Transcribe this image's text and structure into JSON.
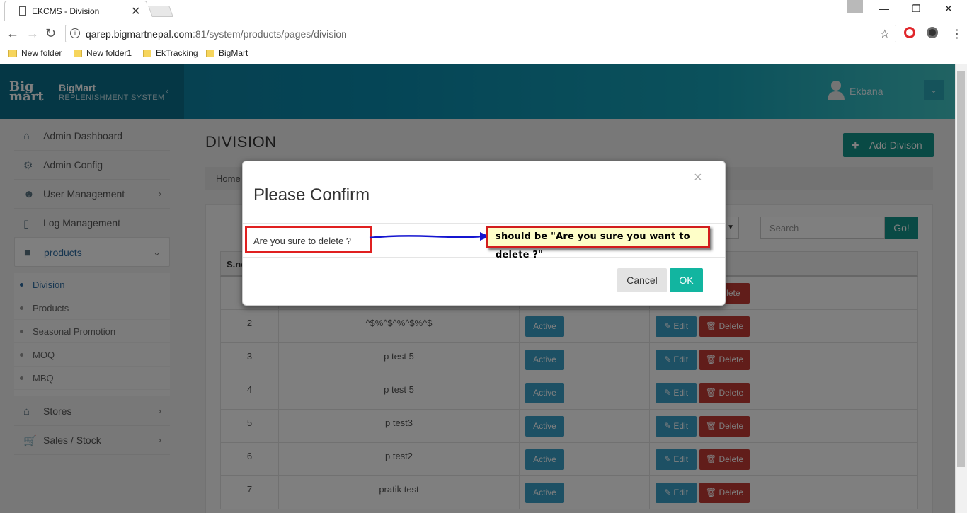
{
  "browser": {
    "tab_title": "EKCMS - Division",
    "url_host": "qarep.bigmartnepal.com",
    "url_rest": ":81/system/products/pages/division",
    "bookmarks": [
      "New folder",
      "New folder1",
      "EkTracking",
      "BigMart"
    ]
  },
  "header": {
    "brand_name": "BigMart",
    "brand_sub": "REPLENISHMENT SYSTEM",
    "user_name": "Ekbana"
  },
  "sidebar": {
    "items": [
      {
        "label": "Admin Dashboard",
        "icon": "home-icon"
      },
      {
        "label": "Admin Config",
        "icon": "gear-icon"
      },
      {
        "label": "User Management",
        "icon": "users-icon"
      },
      {
        "label": "Log Management",
        "icon": "file-icon"
      },
      {
        "label": "products",
        "icon": "briefcase-icon"
      },
      {
        "label": "Stores",
        "icon": "home-icon"
      },
      {
        "label": "Sales / Stock",
        "icon": "cart-icon"
      }
    ],
    "sub_items": [
      "Division",
      "Products",
      "Seasonal Promotion",
      "MOQ",
      "MBQ"
    ]
  },
  "page": {
    "title": "DIVISION",
    "add_button": "Add Divison",
    "breadcrumb_home": "Home",
    "search_placeholder": "Search",
    "go_label": "Go!"
  },
  "table": {
    "header_sno": "S.no",
    "rows": [
      {
        "sno": "2",
        "name": "^$%^$^%^$%^$",
        "status": "Active"
      },
      {
        "sno": "3",
        "name": "p test 5",
        "status": "Active"
      },
      {
        "sno": "4",
        "name": "p test 5",
        "status": "Active"
      },
      {
        "sno": "5",
        "name": "p test3",
        "status": "Active"
      },
      {
        "sno": "6",
        "name": "p test2",
        "status": "Active"
      },
      {
        "sno": "7",
        "name": "pratik test",
        "status": "Active"
      }
    ],
    "edit_label": "Edit",
    "delete_label": "Delete",
    "row1_delete_partial": "elete"
  },
  "modal": {
    "title": "Please Confirm",
    "message": "Are you sure to delete ?",
    "cancel_label": "Cancel",
    "ok_label": "OK",
    "close_glyph": "×"
  },
  "annotation": {
    "note": "should be \"Are you sure you want to delete ?\""
  },
  "colors": {
    "accent": "#12958a",
    "ok_button": "#12b5a0",
    "delete": "#c23a35",
    "active_badge": "#3aa0c9",
    "annotation_red": "#e02020",
    "arrow_blue": "#1515d0"
  }
}
